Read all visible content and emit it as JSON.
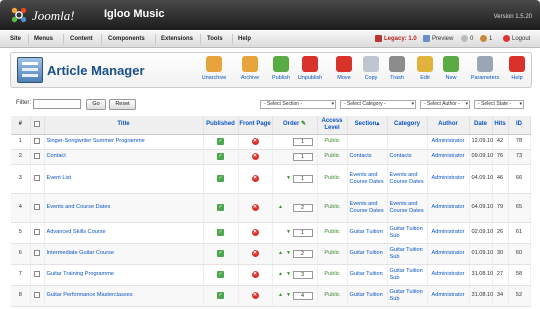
{
  "header": {
    "brand": "Joomla!",
    "site_name": "Igloo Music",
    "version": "Version 1.5.20"
  },
  "menu": [
    "Site",
    "Menus",
    "Content",
    "Components",
    "Extensions",
    "Tools",
    "Help"
  ],
  "status": {
    "legacy": "Legacy: 1.0",
    "preview": "Preview",
    "messages": "0",
    "users": "1",
    "logout": "Logout"
  },
  "toolbar": {
    "title": "Article Manager",
    "buttons": [
      {
        "label": "Unarchive",
        "icon": "unarchive-icon",
        "color": "#e8a43c"
      },
      {
        "label": "Archive",
        "icon": "archive-icon",
        "color": "#e8a43c"
      },
      {
        "label": "Publish",
        "icon": "publish-icon",
        "color": "#5aaa46"
      },
      {
        "label": "Unpublish",
        "icon": "unpublish-icon",
        "color": "#d9322b"
      },
      {
        "label": "Move",
        "icon": "move-icon",
        "color": "#d9322b"
      },
      {
        "label": "Copy",
        "icon": "copy-icon",
        "color": "#bfc6cf"
      },
      {
        "label": "Trash",
        "icon": "trash-icon",
        "color": "#8c8c8c"
      },
      {
        "label": "Edit",
        "icon": "edit-icon",
        "color": "#e0b43c"
      },
      {
        "label": "New",
        "icon": "new-icon",
        "color": "#5aaa46"
      },
      {
        "label": "Parameters",
        "icon": "parameters-icon",
        "color": "#9aa6b4"
      },
      {
        "label": "Help",
        "icon": "help-icon",
        "color": "#d9322b"
      }
    ]
  },
  "filter": {
    "label": "Filter:",
    "value": "",
    "go": "Go",
    "reset": "Reset",
    "section": "- Select Section -",
    "category": "- Select Category -",
    "author": "- Select Author -",
    "state": "- Select State -"
  },
  "columns": {
    "num": "#",
    "title": "Title",
    "published": "Published",
    "front_page": "Front Page",
    "order": "Order",
    "access": "Access Level",
    "section": "Section",
    "category": "Category",
    "author": "Author",
    "date": "Date",
    "hits": "Hits",
    "id": "ID"
  },
  "rows": [
    {
      "num": "1",
      "title": "Singer-Songwriter Summer Programme",
      "order": "1",
      "up": false,
      "down": false,
      "access": "Public",
      "section": "",
      "category": "",
      "author": "Administrator",
      "date": "12.09.10",
      "hits": "42",
      "id": "78"
    },
    {
      "num": "2",
      "title": "Contact",
      "order": "1",
      "up": false,
      "down": false,
      "access": "Public",
      "section": "Contacts",
      "category": "Contacts",
      "author": "Administrator",
      "date": "09.09.10",
      "hits": "76",
      "id": "73"
    },
    {
      "num": "3",
      "title": "Event List",
      "order": "1",
      "up": false,
      "down": true,
      "access": "Public",
      "section": "Events and Course Dates",
      "category": "Events and Course Dates",
      "author": "Administrator",
      "date": "04.09.10",
      "hits": "46",
      "id": "66"
    },
    {
      "num": "4",
      "title": "Events and Course Dates",
      "order": "2",
      "up": true,
      "down": false,
      "access": "Public",
      "section": "Events and Course Dates",
      "category": "Events and Course Dates",
      "author": "Administrator",
      "date": "04.09.10",
      "hits": "79",
      "id": "65"
    },
    {
      "num": "5",
      "title": "Advanced Skills Course",
      "order": "1",
      "up": false,
      "down": true,
      "access": "Public",
      "section": "Guitar Tuition",
      "category": "Guitar Tuition Sub",
      "author": "Administrator",
      "date": "02.09.10",
      "hits": "26",
      "id": "61"
    },
    {
      "num": "6",
      "title": "Intermediate Guitar Course",
      "order": "2",
      "up": true,
      "down": true,
      "access": "Public",
      "section": "Guitar Tuition",
      "category": "Guitar Tuition Sub",
      "author": "Administrator",
      "date": "01.09.10",
      "hits": "30",
      "id": "60"
    },
    {
      "num": "7",
      "title": "Guitar Training Programme",
      "order": "3",
      "up": true,
      "down": true,
      "access": "Public",
      "section": "Guitar Tuition",
      "category": "Guitar Tuition Sub",
      "author": "Administrator",
      "date": "31.08.10",
      "hits": "27",
      "id": "58"
    },
    {
      "num": "8",
      "title": "Guitar Performance Masterclasses",
      "order": "4",
      "up": true,
      "down": true,
      "access": "Public",
      "section": "Guitar Tuition",
      "category": "Guitar Tuition Sub",
      "author": "Administrator",
      "date": "31.08.10",
      "hits": "34",
      "id": "52"
    }
  ]
}
